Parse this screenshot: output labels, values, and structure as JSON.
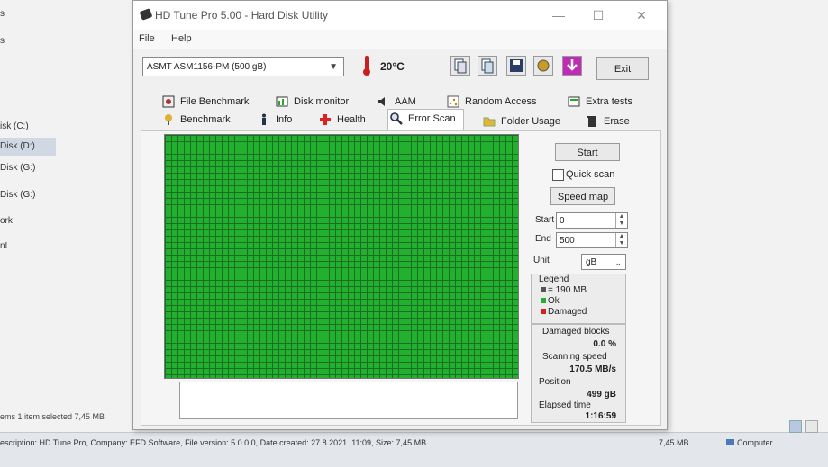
{
  "explorer": {
    "nav": [
      "s",
      "s",
      "isk (C:)",
      "Disk (D:)",
      "Disk (G:)",
      "Disk (G:)",
      "ork",
      "n!"
    ],
    "status": "ems    1 item selected  7,45 MB",
    "bottom_description": "escription: HD Tune Pro, Company: EFD Software, File version: 5.0.0.0, Date created: 27.8.2021. 11:09, Size: 7,45 MB",
    "bottom_size": "7,45 MB",
    "bottom_computer": "Computer"
  },
  "window": {
    "title": "HD Tune Pro 5.00 - Hard Disk Utility",
    "controls": {
      "minimize": "—",
      "maximize": "☐",
      "close": "✕"
    }
  },
  "menu": {
    "file": "File",
    "help": "Help"
  },
  "toolbar": {
    "drive": "ASMT    ASM1156-PM        (500 gB)",
    "temperature": "20°C",
    "exit_label": "Exit"
  },
  "tabs": {
    "row1": [
      "File Benchmark",
      "Disk monitor",
      "AAM",
      "Random Access",
      "Extra tests"
    ],
    "row2": [
      "Benchmark",
      "Info",
      "Health",
      "Error Scan",
      "Folder Usage",
      "Erase"
    ],
    "active": "Error Scan"
  },
  "error_scan": {
    "start_button": "Start",
    "quick_scan_label": "Quick scan",
    "quick_scan_checked": false,
    "speed_map_button": "Speed map",
    "start_label": "Start",
    "start_value": "0",
    "end_label": "End",
    "end_value": "500",
    "unit_label": "Unit",
    "unit_value": "gB",
    "legend_title": "Legend",
    "legend_block": "= 190 MB",
    "legend_ok": "Ok",
    "legend_damaged": "Damaged",
    "damaged_blocks_label": "Damaged blocks",
    "damaged_blocks_value": "0.0 %",
    "scanning_speed_label": "Scanning speed",
    "scanning_speed_value": "170.5 MB/s",
    "position_label": "Position",
    "position_value": "499 gB",
    "elapsed_label": "Elapsed time",
    "elapsed_value": "1:16:59"
  },
  "colors": {
    "ok": "#22b02e",
    "damaged": "#d42020",
    "block": "#555555"
  }
}
